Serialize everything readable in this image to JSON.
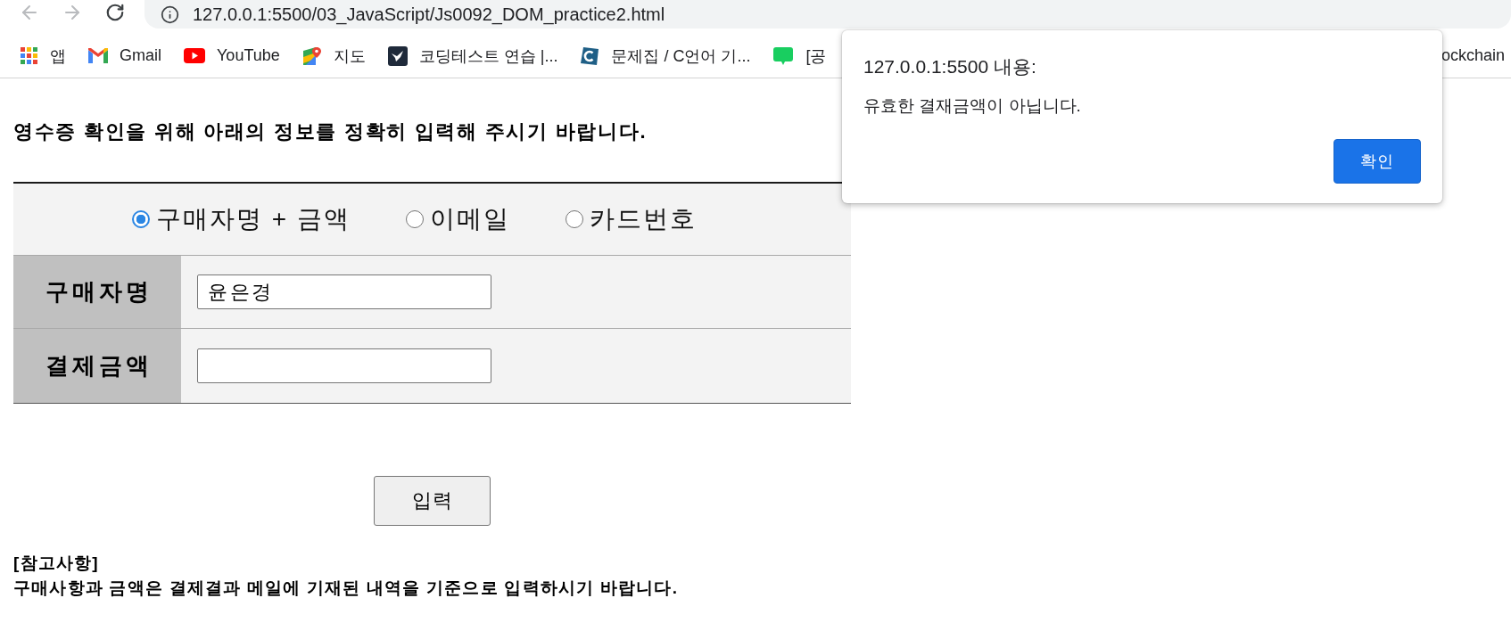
{
  "browser": {
    "address": "127.0.0.1:5500/03_JavaScript/Js0092_DOM_practice2.html",
    "bookmarks": [
      {
        "label": "앱"
      },
      {
        "label": "Gmail"
      },
      {
        "label": "YouTube"
      },
      {
        "label": "지도"
      },
      {
        "label": "코딩테스트 연습 |..."
      },
      {
        "label": "문제집 / C언어 기..."
      },
      {
        "label": "[공"
      }
    ],
    "bookmarks_right": [
      {
        "label": "ockchain"
      }
    ]
  },
  "page": {
    "heading": "영수증 확인을 위해 아래의 정보를 정확히 입력해 주시기 바랍니다.",
    "search_options": [
      {
        "label": "구매자명 + 금액",
        "selected": true
      },
      {
        "label": "이메일",
        "selected": false
      },
      {
        "label": "카드번호",
        "selected": false
      }
    ],
    "fields": [
      {
        "label": "구매자명",
        "value": "윤은경"
      },
      {
        "label": "결제금액"
      }
    ],
    "submit_button": "입력",
    "notes": {
      "title": "[참고사항]",
      "text": "구매사항과 금액은 결제결과 메일에 기재된 내역을 기준으로 입력하시기 바랍니다."
    }
  },
  "alert": {
    "title": "127.0.0.1:5500 내용:",
    "message": "유효한 결재금액이 아닙니다.",
    "button": "확인"
  }
}
